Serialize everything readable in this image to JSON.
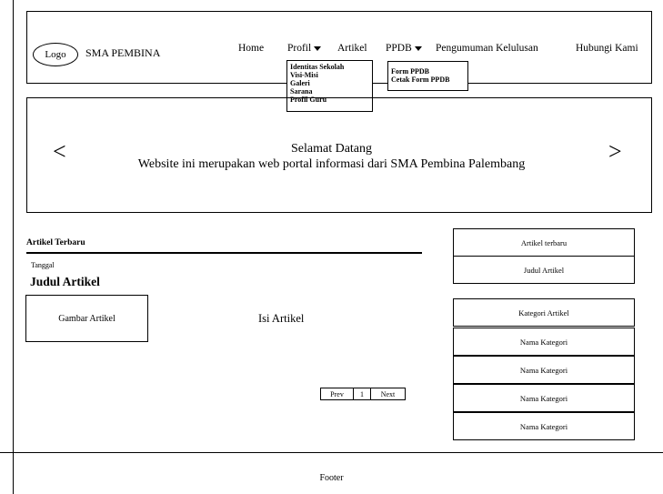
{
  "header": {
    "logo_label": "Logo",
    "site_name": "SMA PEMBINA",
    "nav": {
      "home": "Home",
      "profil": "Profil",
      "artikel": "Artikel",
      "ppdb": "PPDB",
      "pengumuman": "Pengumuman Kelulusan",
      "hubungi": "Hubungi Kami"
    },
    "profil_menu": [
      "Identitas Sekolah",
      "Visi-Misi",
      "Galeri",
      "Sarana",
      "Profil Guru"
    ],
    "ppdb_menu": [
      "Form PPDB",
      "Cetak Form PPDB"
    ]
  },
  "banner": {
    "prev": "<",
    "next": ">",
    "title": "Selamat Datang",
    "subtitle": "Website ini merupakan web portal informasi dari SMA Pembina Palembang"
  },
  "articles": {
    "section_title": "Artikel Terbaru",
    "date_label": "Tanggal",
    "article_title": "Judul Artikel",
    "image_placeholder": "Gambar Artikel",
    "content": "Isi Artikel",
    "pager": {
      "prev": "Prev",
      "page": "1",
      "next": "Next"
    }
  },
  "sidebar": {
    "recent_header": "Artikel terbaru",
    "recent_item": "Judul Artikel",
    "category_header": "Kategori Artikel",
    "categories": [
      "Nama Kategori",
      "Nama Kategori",
      "Nama Kategori",
      "Nama Kategori"
    ]
  },
  "footer": {
    "text": "Footer"
  }
}
